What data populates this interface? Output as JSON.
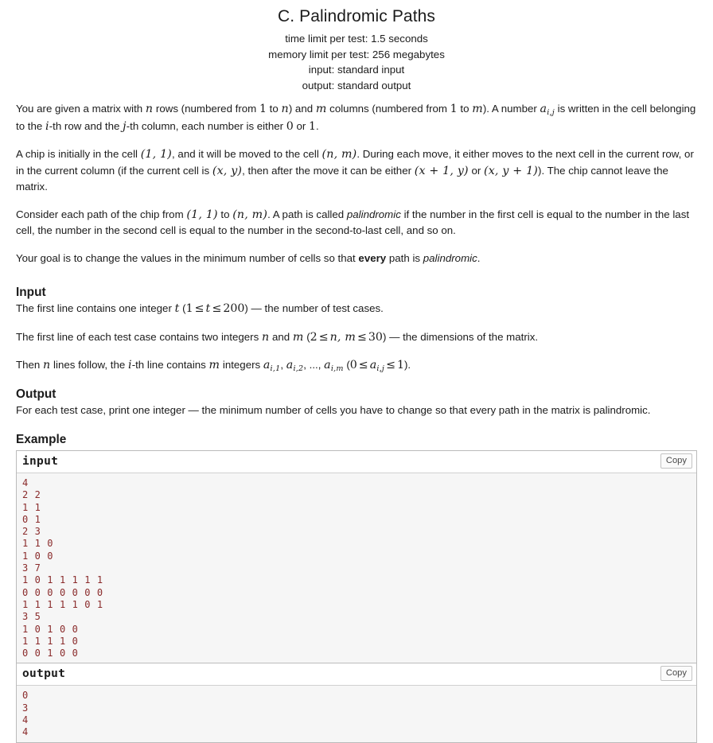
{
  "problem": {
    "title": "C. Palindromic Paths",
    "time_limit": "time limit per test: 1.5 seconds",
    "memory_limit": "memory limit per test: 256 megabytes",
    "input_stream": "input: standard input",
    "output_stream": "output: standard output"
  },
  "statement": {
    "p1_a": "You are given a matrix with ",
    "p1_n1": "n",
    "p1_b": " rows (numbered from ",
    "p1_one": "1",
    "p1_c": " to ",
    "p1_n2": "n",
    "p1_d": ") and ",
    "p1_m1": "m",
    "p1_e": " columns (numbered from ",
    "p1_one2": "1",
    "p1_f": " to ",
    "p1_m2": "m",
    "p1_g": "). A number ",
    "p1_a_ij": "a",
    "p1_a_ij_sub": "i,j",
    "p1_h": " is written in the cell belonging to the ",
    "p1_i": "i",
    "p1_j": "-th row and the ",
    "p1_k": "j",
    "p1_l": "-th column, each number is either ",
    "p1_zero": "0",
    "p1_m": " or ",
    "p1_one3": "1",
    "p1_n": ".",
    "p2_a": "A chip is initially in the cell ",
    "p2_cell11": "(1, 1)",
    "p2_b": ", and it will be moved to the cell ",
    "p2_cellnm": "(n, m)",
    "p2_c": ". During each move, it either moves to the next cell in the current row, or in the current column (if the current cell is ",
    "p2_cellxy": "(x, y)",
    "p2_d": ", then after the move it can be either ",
    "p2_mv1": "(x + 1, y)",
    "p2_e": " or ",
    "p2_mv2": "(x, y + 1)",
    "p2_f": "). The chip cannot leave the matrix.",
    "p3_a": "Consider each path of the chip from ",
    "p3_cell11": "(1, 1)",
    "p3_b": " to ",
    "p3_cellnm": "(n, m)",
    "p3_c": ". A path is called ",
    "p3_pal": "palindromic",
    "p3_d": " if the number in the first cell is equal to the number in the last cell, the number in the second cell is equal to the number in the second-to-last cell, and so on.",
    "p4_a": "Your goal is to change the values in the minimum number of cells so that ",
    "p4_every": "every",
    "p4_b": " path is ",
    "p4_pal": "palindromic",
    "p4_c": "."
  },
  "input_section": {
    "heading": "Input",
    "l1_a": "The first line contains one integer ",
    "l1_t": "t",
    "l1_b": " (",
    "l1_range_1": "1",
    "l1_le1": "≤",
    "l1_t2": "t",
    "l1_le2": "≤",
    "l1_range_200": "200",
    "l1_c": ") — the number of test cases.",
    "l2_a": "The first line of each test case contains two integers ",
    "l2_n": "n",
    "l2_b": " and ",
    "l2_m": "m",
    "l2_c": " (",
    "l2_two": "2",
    "l2_le1": "≤",
    "l2_nm": "n, m",
    "l2_le2": "≤",
    "l2_30": "30",
    "l2_d": ") — the dimensions of the matrix.",
    "l3_a": "Then ",
    "l3_n": "n",
    "l3_b": " lines follow, the ",
    "l3_i": "i",
    "l3_c": "-th line contains ",
    "l3_m": "m",
    "l3_d": " integers ",
    "l3_a1": "a",
    "l3_a1s": "i,1",
    "l3_comma1": ", ",
    "l3_a2": "a",
    "l3_a2s": "i,2",
    "l3_dots": ", ..., ",
    "l3_am": "a",
    "l3_ams": "i,m",
    "l3_e": " (",
    "l3_zero": "0",
    "l3_le1": "≤",
    "l3_aij": "a",
    "l3_aijs": "i,j",
    "l3_le2": "≤",
    "l3_one": "1",
    "l3_f": ")."
  },
  "output_section": {
    "heading": "Output",
    "text": "For each test case, print one integer — the minimum number of cells you have to change so that every path in the matrix is palindromic."
  },
  "example": {
    "heading": "Example",
    "copy_label": "Copy",
    "input_label": "input",
    "output_label": "output",
    "input_data": "4\n2 2\n1 1\n0 1\n2 3\n1 1 0\n1 0 0\n3 7\n1 0 1 1 1 1 1\n0 0 0 0 0 0 0\n1 1 1 1 1 0 1\n3 5\n1 0 1 0 0\n1 1 1 1 0\n0 0 1 0 0",
    "output_data": "0\n3\n4\n4"
  },
  "colors": {
    "sample_text": "#8a2b2b",
    "sample_bg": "#f6f6f6",
    "border": "#bbbbbb"
  }
}
